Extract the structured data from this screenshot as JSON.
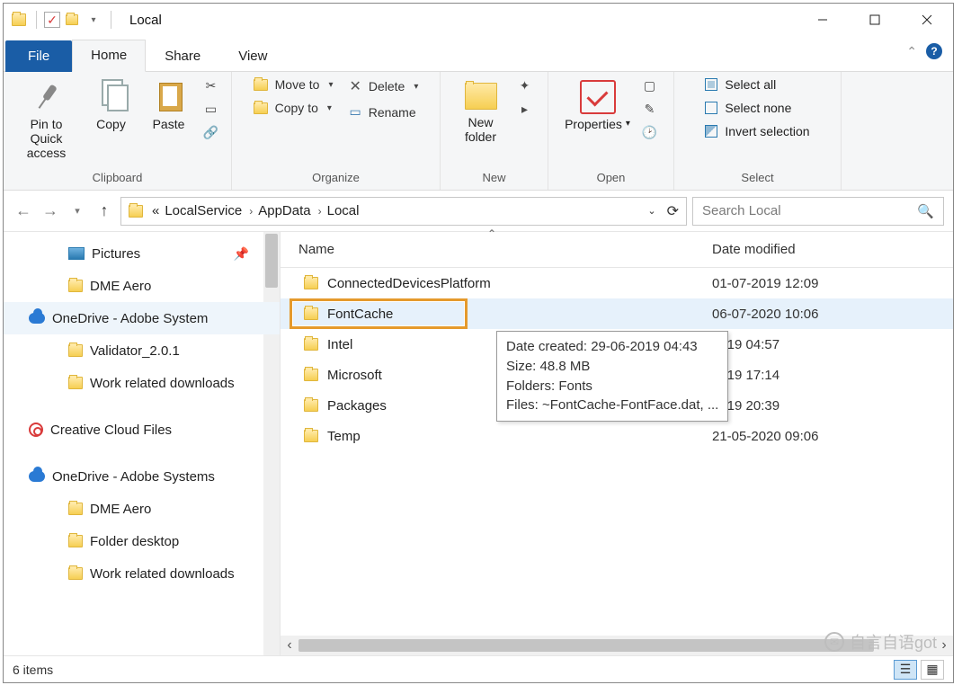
{
  "title": "Local",
  "tabs": {
    "file": "File",
    "home": "Home",
    "share": "Share",
    "view": "View"
  },
  "ribbon": {
    "clipboard": {
      "label": "Clipboard",
      "pin": "Pin to Quick\naccess",
      "copy": "Copy",
      "paste": "Paste"
    },
    "organize": {
      "label": "Organize",
      "move": "Move to",
      "copy": "Copy to",
      "delete": "Delete",
      "rename": "Rename"
    },
    "new": {
      "label": "New",
      "newfolder": "New\nfolder"
    },
    "open": {
      "label": "Open",
      "properties": "Properties"
    },
    "select": {
      "label": "Select",
      "all": "Select all",
      "none": "Select none",
      "invert": "Invert selection"
    }
  },
  "breadcrumb": {
    "prefix": "«",
    "items": [
      "LocalService",
      "AppData",
      "Local"
    ]
  },
  "search": {
    "placeholder": "Search Local"
  },
  "columns": {
    "name": "Name",
    "date": "Date modified"
  },
  "tree": {
    "items": [
      {
        "label": "Pictures",
        "icon": "pic",
        "indent": 2,
        "pin": true
      },
      {
        "label": "DME Aero",
        "icon": "folder",
        "indent": 2
      },
      {
        "label": "OneDrive - Adobe System",
        "icon": "cloud",
        "indent": 1,
        "hilite": true
      },
      {
        "label": "Validator_2.0.1",
        "icon": "folder",
        "indent": 2
      },
      {
        "label": "Work related downloads",
        "icon": "folder",
        "indent": 2
      },
      {
        "label": "",
        "icon": "blank",
        "indent": 0
      },
      {
        "label": "Creative Cloud Files",
        "icon": "cc",
        "indent": 1
      },
      {
        "label": "",
        "icon": "blank",
        "indent": 0
      },
      {
        "label": "OneDrive - Adobe Systems",
        "icon": "cloud",
        "indent": 1
      },
      {
        "label": "DME Aero",
        "icon": "folder",
        "indent": 2
      },
      {
        "label": "Folder desktop",
        "icon": "folder",
        "indent": 2
      },
      {
        "label": "Work related downloads",
        "icon": "folder",
        "indent": 2
      }
    ]
  },
  "files": {
    "rows": [
      {
        "name": "ConnectedDevicesPlatform",
        "date": "01-07-2019 12:09"
      },
      {
        "name": "FontCache",
        "date": "06-07-2020 10:06",
        "selected": true
      },
      {
        "name": "Intel",
        "date": "2019 04:57"
      },
      {
        "name": "Microsoft",
        "date": "2019 17:14"
      },
      {
        "name": "Packages",
        "date": "2019 20:39"
      },
      {
        "name": "Temp",
        "date": "21-05-2020 09:06"
      }
    ]
  },
  "tooltip": {
    "line1": "Date created: 29-06-2019 04:43",
    "line2": "Size: 48.8 MB",
    "line3": "Folders: Fonts",
    "line4": "Files: ~FontCache-FontFace.dat, ..."
  },
  "status": {
    "count": "6 items"
  },
  "watermark": "自言自语got"
}
